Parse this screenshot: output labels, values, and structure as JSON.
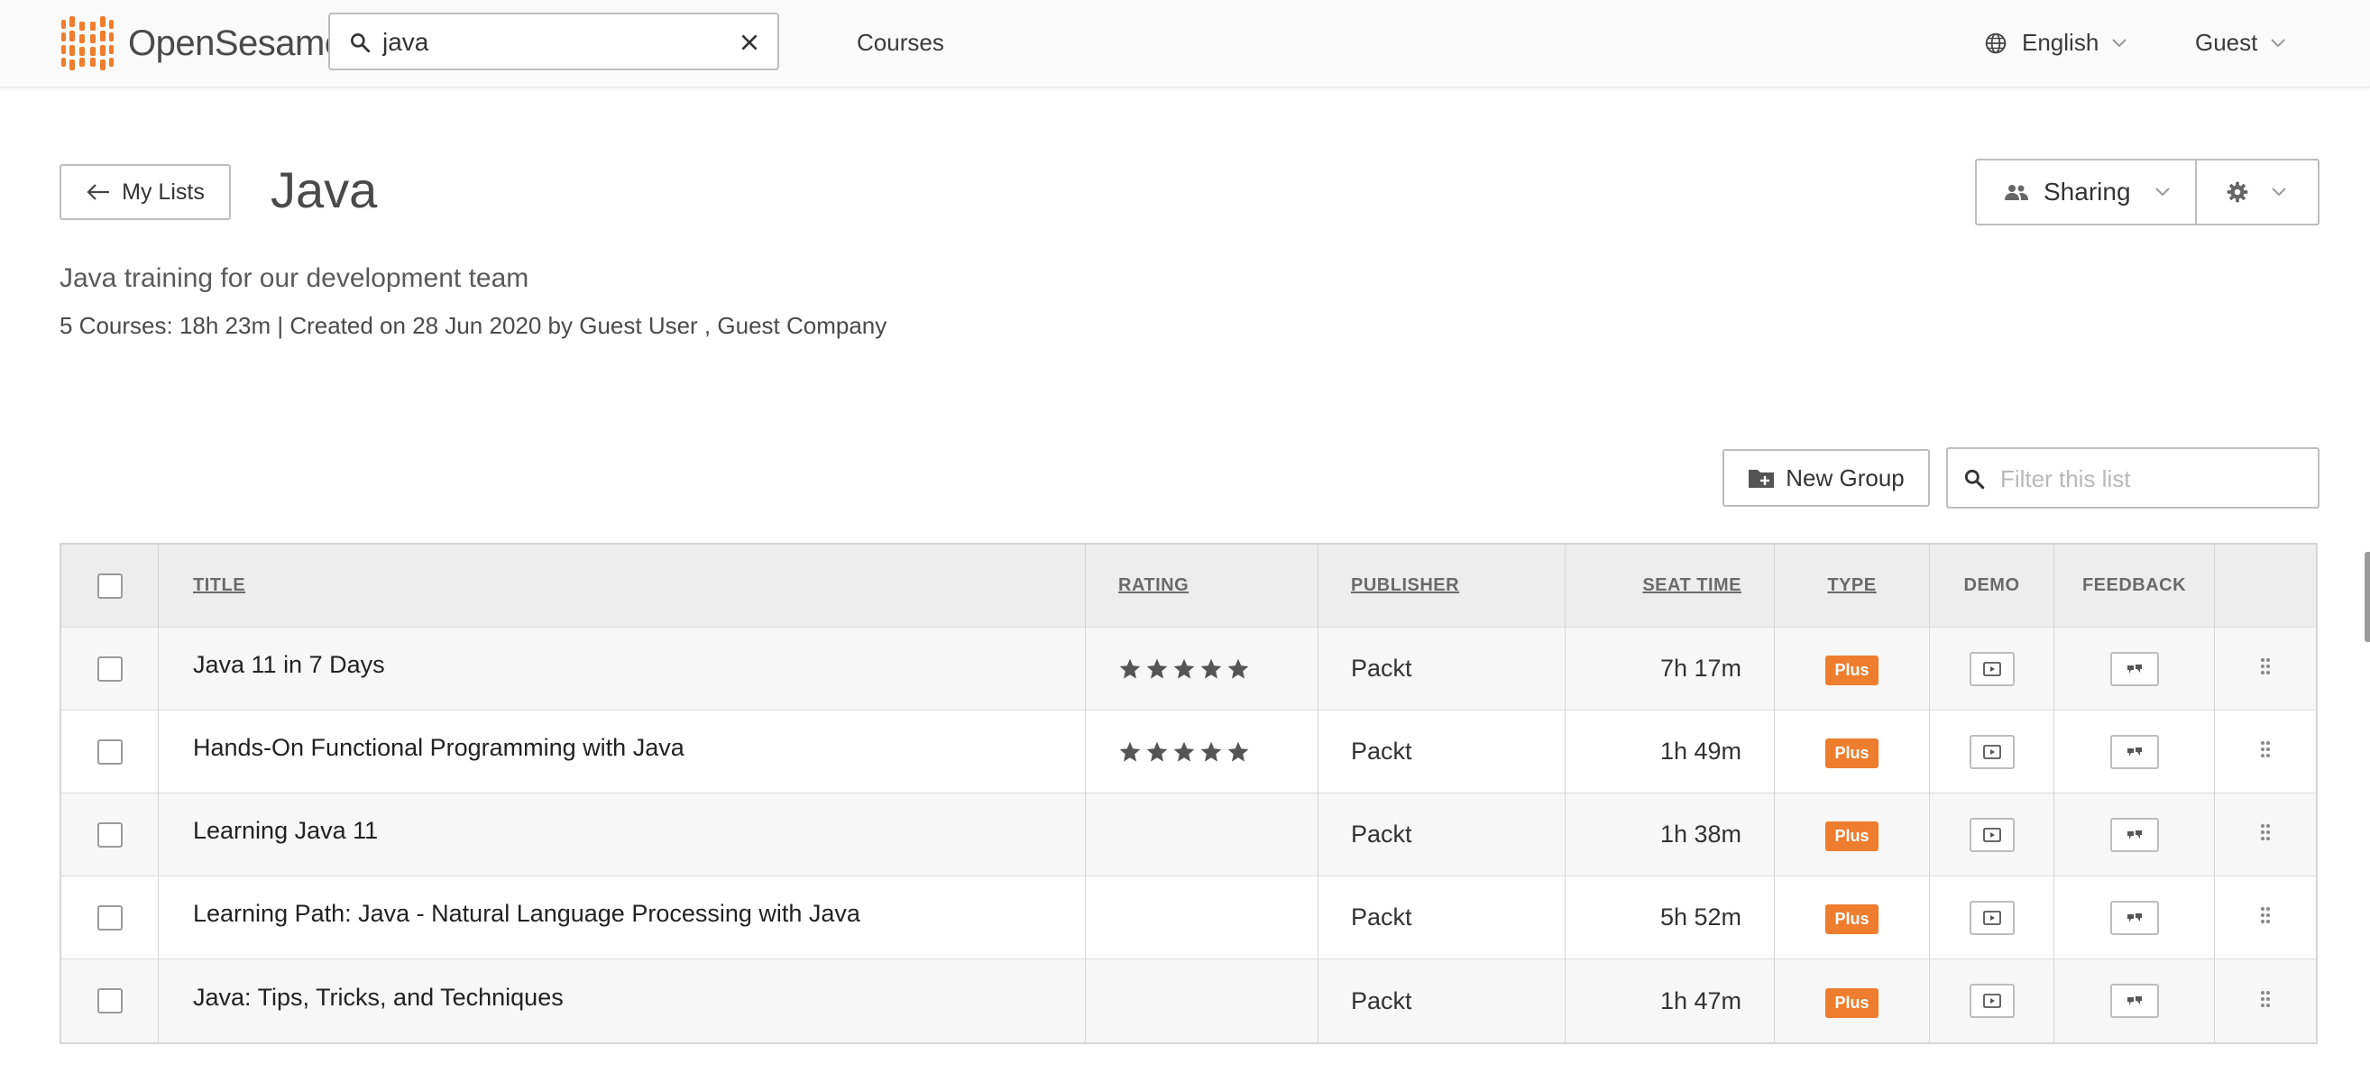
{
  "app": {
    "logo_text": "OpenSesame",
    "brand_color": "#ee7d2e"
  },
  "topbar": {
    "search_value": "java",
    "nav_courses": "Courses",
    "language": "English",
    "user": "Guest"
  },
  "header": {
    "back_label": "My Lists",
    "title": "Java",
    "sharing_label": "Sharing",
    "description": "Java training for our development team",
    "meta": "5 Courses: 18h 23m | Created on 28 Jun 2020 by Guest User , Guest Company"
  },
  "toolbar": {
    "new_group_label": "New Group",
    "filter_placeholder": "Filter this list"
  },
  "table": {
    "columns": {
      "title": "TITLE",
      "rating": "RATING",
      "publisher": "PUBLISHER",
      "seat_time": "SEAT TIME",
      "type": "TYPE",
      "demo": "DEMO",
      "feedback": "FEEDBACK"
    },
    "rows": [
      {
        "title": "Java 11 in 7 Days",
        "rating": 5,
        "publisher": "Packt",
        "seat_time": "7h 17m",
        "type": "Plus"
      },
      {
        "title": "Hands-On Functional Programming with Java",
        "rating": 5,
        "publisher": "Packt",
        "seat_time": "1h 49m",
        "type": "Plus"
      },
      {
        "title": "Learning Java 11",
        "rating": 0,
        "publisher": "Packt",
        "seat_time": "1h 38m",
        "type": "Plus"
      },
      {
        "title": "Learning Path: Java - Natural Language Processing with Java",
        "rating": 0,
        "publisher": "Packt",
        "seat_time": "5h 52m",
        "type": "Plus"
      },
      {
        "title": "Java: Tips, Tricks, and Techniques",
        "rating": 0,
        "publisher": "Packt",
        "seat_time": "1h 47m",
        "type": "Plus"
      }
    ]
  }
}
